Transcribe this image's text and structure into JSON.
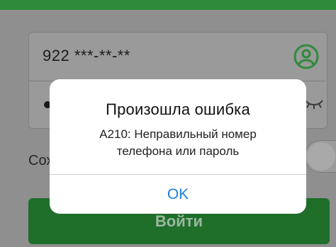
{
  "form": {
    "phone_value": "922  ***-**-**",
    "remember_label": "Сохр",
    "login_button_label": "Войти"
  },
  "alert": {
    "title": "Произошла ошибка",
    "message_line1": "A210: Неправильный номер",
    "message_line2": "телефона или пароль",
    "ok_label": "OK"
  },
  "icons": {
    "user": "user-circle-icon",
    "eye": "eye-closed-icon"
  },
  "colors": {
    "brand_green": "#1f6e2a",
    "icon_green": "#2f8a3b",
    "alert_button_blue": "#1f7fd6"
  }
}
